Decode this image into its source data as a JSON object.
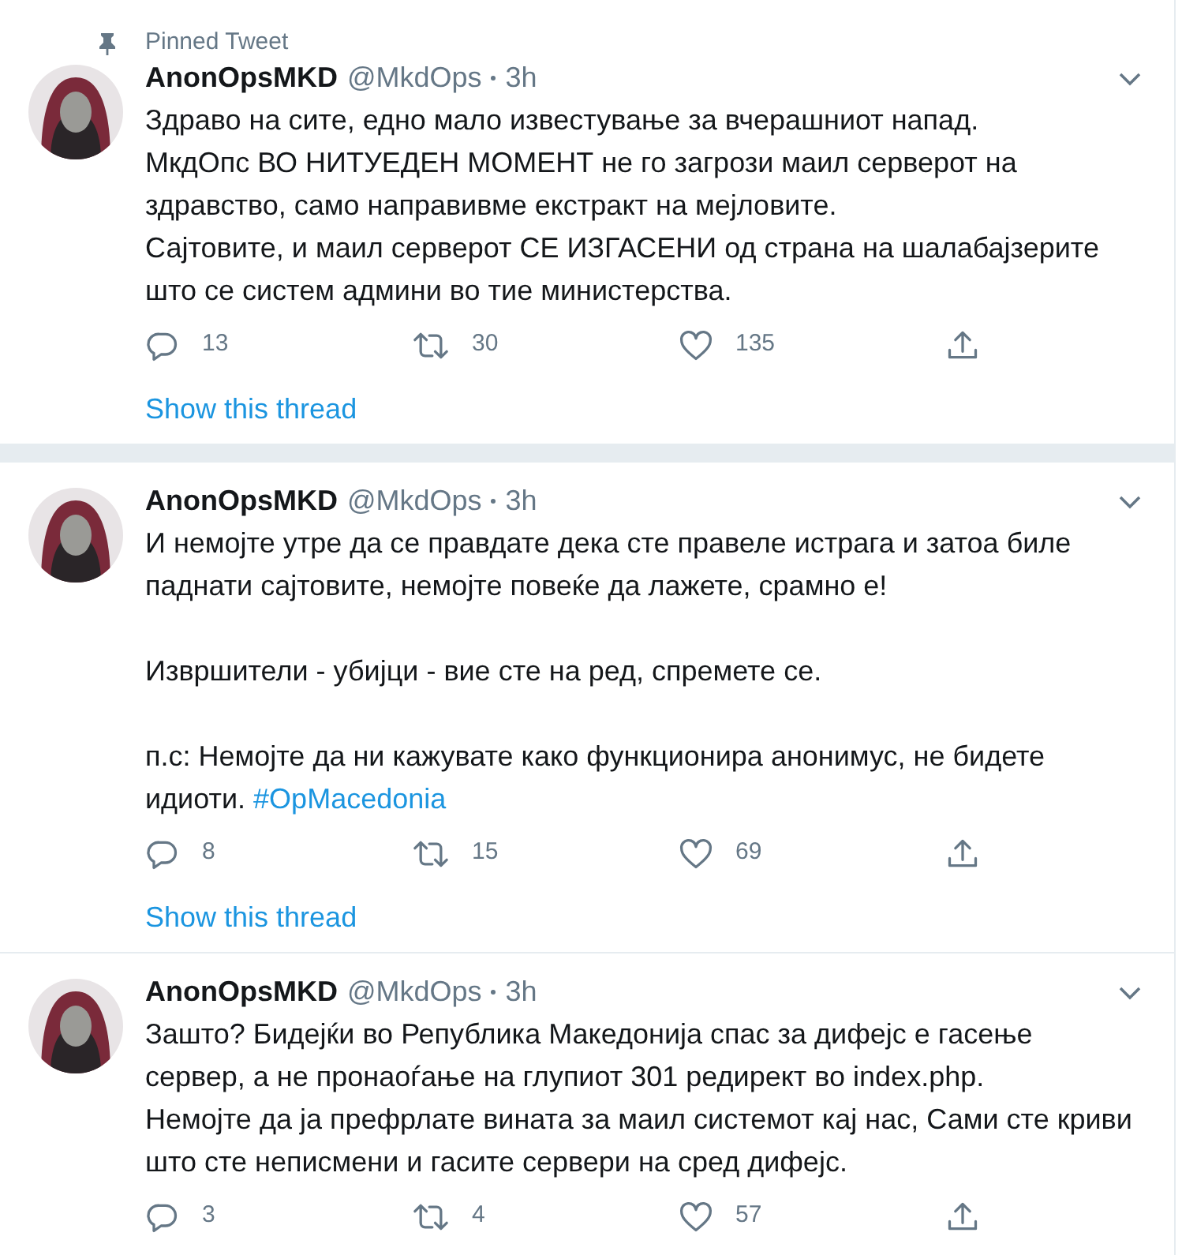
{
  "tweets": [
    {
      "pinned_label": "Pinned Tweet",
      "name": "AnonOpsMKD",
      "handle": "@MkdOps",
      "time": "3h",
      "paragraphs": [
        {
          "text": "Здраво на сите, едно мало известување за вчерашниот напад.\nМкдОпс ВО НИТУЕДЕН МОМЕНТ не го загрози маил серверот на здравство, само направивме екстракт на мејловите.\nСајтовите, и маил серверот СЕ ИЗГАСЕНИ од страна на шалабајзерите што се систем админи во тие министерства."
        }
      ],
      "replies": "13",
      "retweets": "30",
      "likes": "135",
      "thread_link": "Show this thread"
    },
    {
      "name": "AnonOpsMKD",
      "handle": "@MkdOps",
      "time": "3h",
      "paragraphs": [
        {
          "text": "И немојте утре да се правдате дека сте правеле истрага и затоа биле паднати сајтовите, немојте повеќе да лажете, срамно е!"
        },
        {
          "text": "Извршители - убијци - вие сте на ред, спремете се."
        },
        {
          "text": "п.с: Немојте да ни кажувате како функционира анонимус, не бидете идиоти.",
          "hashtag": "#OpMacedonia"
        }
      ],
      "replies": "8",
      "retweets": "15",
      "likes": "69",
      "thread_link": "Show this thread"
    },
    {
      "name": "AnonOpsMKD",
      "handle": "@MkdOps",
      "time": "3h",
      "paragraphs": [
        {
          "text": "Зашто? Бидејќи во Република Македонија спас за дифејс е гасење сервер, а не пронаоѓање на глупиот 301 редирект во index.php.\nНемојте да ја префрлате вината за маил системот кај нас, Сами сте криви што сте неписмени и гасите сервери на сред дифејс."
        }
      ],
      "replies": "3",
      "retweets": "4",
      "likes": "57"
    }
  ]
}
